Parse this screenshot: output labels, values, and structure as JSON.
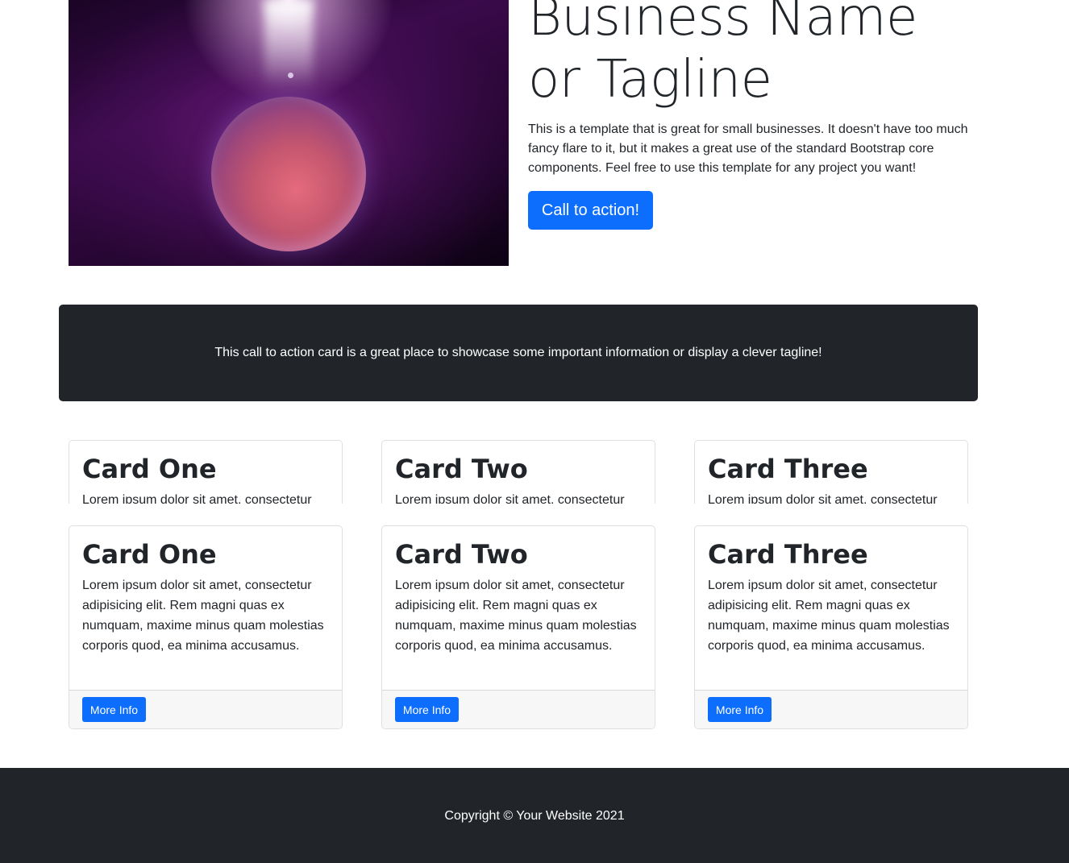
{
  "hero": {
    "title": "Business Name or Tagline",
    "text": "This is a template that is great for small businesses. It doesn't have too much fancy flare to it, but it makes a great use of the standard Bootstrap core components. Feel free to use this template for any project you want!",
    "button_label": "Call to action!"
  },
  "cta_card": {
    "text": "This call to action card is a great place to showcase some important information or display a clever tagline!"
  },
  "cards_row1": [
    {
      "title": "Card One",
      "text": "Lorem ipsum dolor sit amet, consectetur adipisicing elit. Rem magni quas ex numquam, maxime minus quam molestias corporis quod, ea minima accusamus."
    },
    {
      "title": "Card Two",
      "text": "Lorem ipsum dolor sit amet, consectetur adipisicing elit. Rem magni quas ex numquam, maxime minus quam molestias corporis quod, ea minima accusamus."
    },
    {
      "title": "Card Three",
      "text": "Lorem ipsum dolor sit amet, consectetur adipisicing elit. Rem magni quas ex numquam, maxime minus quam molestias corporis quod, ea minima accusamus."
    }
  ],
  "cards_row2": [
    {
      "title": "Card One",
      "text": "Lorem ipsum dolor sit amet, consectetur adipisicing elit. Rem magni quas ex numquam, maxime minus quam molestias corporis quod, ea minima accusamus.",
      "button_label": "More Info"
    },
    {
      "title": "Card Two",
      "text": "Lorem ipsum dolor sit amet, consectetur adipisicing elit. Rem magni quas ex numquam, maxime minus quam molestias corporis quod, ea minima accusamus.",
      "button_label": "More Info"
    },
    {
      "title": "Card Three",
      "text": "Lorem ipsum dolor sit amet, consectetur adipisicing elit. Rem magni quas ex numquam, maxime minus quam molestias corporis quod, ea minima accusamus.",
      "button_label": "More Info"
    }
  ],
  "footer": {
    "text": "Copyright © Your Website 2021"
  },
  "colors": {
    "primary": "#0d6efd",
    "dark": "#212529",
    "footer_bg": "#212529",
    "card_footer_bg": "#f7f7f7"
  }
}
